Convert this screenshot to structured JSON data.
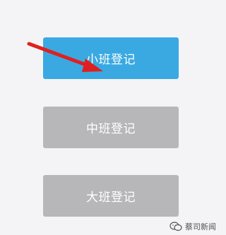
{
  "buttons": {
    "small_label": "小班登记",
    "middle_label": "中班登记",
    "large_label": "大班登记"
  },
  "watermark": {
    "text": "蔡司新闻"
  },
  "colors": {
    "active_button": "#3aa9e2",
    "inactive_button": "#b7b7ba",
    "arrow": "#e02020",
    "background": "#f4f4f6"
  },
  "icons": {
    "pointer": "red-arrow-icon",
    "watermark": "wechat-icon"
  }
}
